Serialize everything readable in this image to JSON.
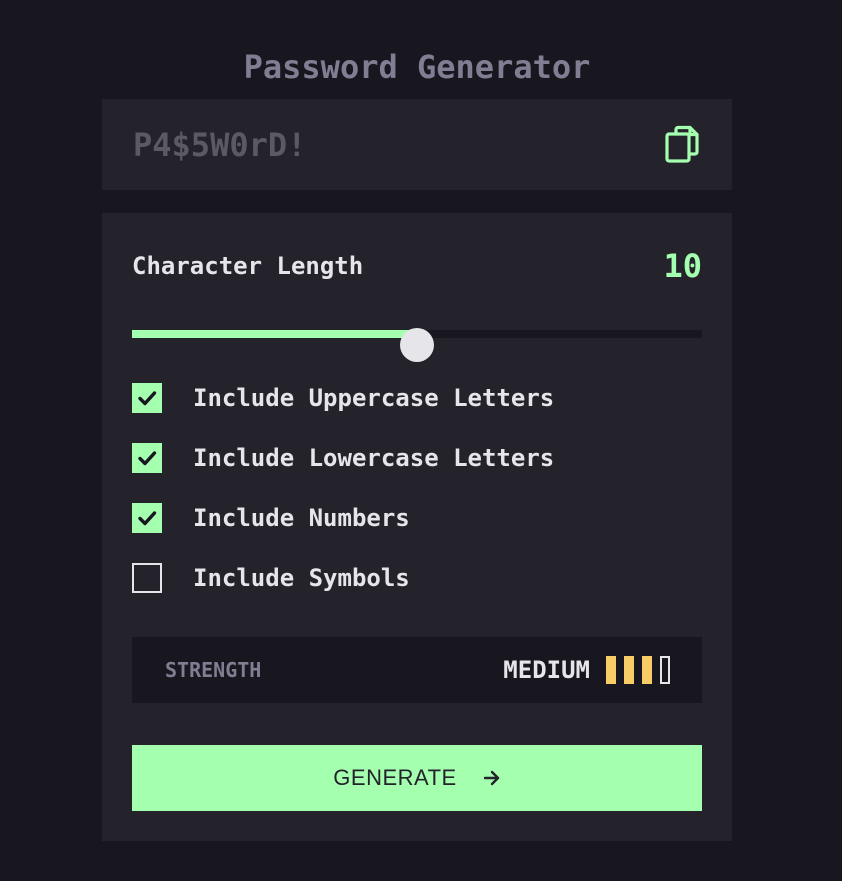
{
  "app": {
    "title": "Password Generator"
  },
  "password": {
    "placeholder": "P4$5W0rD!"
  },
  "length": {
    "label": "Character Length",
    "value": "10",
    "slider_fraction": 0.5
  },
  "options": [
    {
      "label": "Include Uppercase Letters",
      "checked": true
    },
    {
      "label": "Include Lowercase Letters",
      "checked": true
    },
    {
      "label": "Include Numbers",
      "checked": true
    },
    {
      "label": "Include Symbols",
      "checked": false
    }
  ],
  "strength": {
    "label": "STRENGTH",
    "value": "MEDIUM",
    "level": 3,
    "max_level": 4
  },
  "generate": {
    "label": "GENERATE"
  },
  "icons": {
    "copy": "copy-icon",
    "check": "check-icon",
    "arrow": "arrow-right-icon"
  },
  "colors": {
    "background": "#18171f",
    "panel": "#24232c",
    "accent": "#a4ffaf",
    "text": "#e6e5ea",
    "muted": "#817d92",
    "placeholder": "#5b5a63",
    "strength_medium": "#f8cd65"
  }
}
